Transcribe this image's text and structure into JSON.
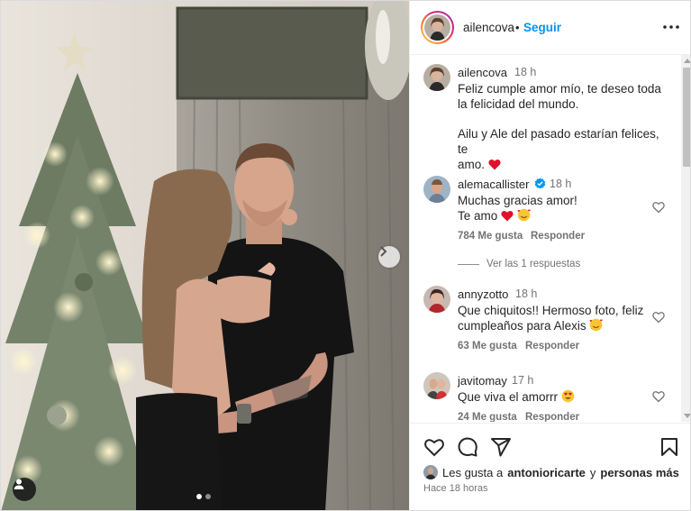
{
  "post": {
    "author": "ailencova",
    "separator": "•",
    "follow_label": "Seguir",
    "caption": {
      "username": "ailencova",
      "time": "18 h",
      "line1": "Feliz cumple amor mío, te deseo toda",
      "line2": "la felicidad del mundo.",
      "line3": "Ailu y Ale del pasado estarían felices, te",
      "line4": "amo."
    },
    "carousel": {
      "count": 2,
      "active": 1
    }
  },
  "comments": [
    {
      "username": "alemacallister",
      "verified": true,
      "time": "18 h",
      "line1": "Muchas gracias amor!",
      "line2": "Te amo",
      "likes": "784 Me gusta",
      "reply": "Responder"
    },
    {
      "username": "annyzotto",
      "time": "18 h",
      "line1": "Que chiquitos!! Hermoso foto, feliz",
      "line2": "cumpleaños para Alexis",
      "likes": "63 Me gusta",
      "reply": "Responder"
    },
    {
      "username": "javitomay",
      "time": "17 h",
      "line1": "Que viva el amorrr",
      "likes": "24 Me gusta",
      "reply": "Responder"
    }
  ],
  "replies_label": "Ver las 1 respuestas",
  "footer": {
    "likes_prefix": "Les gusta a",
    "liked_by": "antonioricarte",
    "conj": "y",
    "others": "personas más",
    "posted": "Hace 18 horas"
  },
  "icons": {
    "more": "more-options-icon",
    "like": "heart-icon",
    "comment": "comment-icon",
    "share": "paper-plane-icon",
    "save": "bookmark-icon",
    "verified": "verified-badge-icon",
    "next": "chevron-right-icon",
    "tag": "user-tag-icon"
  },
  "colors": {
    "accent": "#0095f6",
    "emoji_heart": "#e0112b",
    "verified": "#0095f6"
  }
}
